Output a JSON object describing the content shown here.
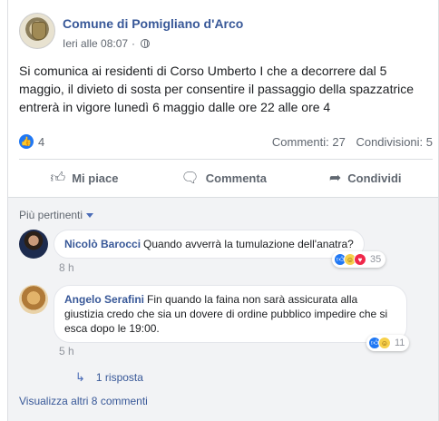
{
  "post": {
    "page_name": "Comune di Pomigliano d'Arco",
    "timestamp": "Ieri alle 08:07",
    "audience_icon": "globe-icon",
    "text": "Si comunica ai residenti di Corso Umberto I che a decorrere dal 5 maggio, il divieto di sosta per consentire il passaggio della spazzatrice entrerà in vigore lunedì 6 maggio dalle ore 22 alle ore 4",
    "likes_count": "4",
    "comments_count": "Commenti: 27",
    "shares_count": "Condivisioni: 5"
  },
  "actions": {
    "like": "Mi piace",
    "comment": "Commenta",
    "share": "Condividi"
  },
  "comments_section": {
    "filter_label": "Più pertinenti",
    "comments": [
      {
        "author": "Nicolò Barocci",
        "text": "Quando avverrà la tumulazione dell'anatra?",
        "time": "8 h",
        "reaction_count": "35"
      },
      {
        "author": "Angelo Serafini",
        "text": "Fin quando la faina non sarà assicurata alla giustizia credo che sia un dovere di ordine pubblico impedire che si esca dopo le 19:00.",
        "time": "5 h",
        "reaction_count": "11"
      }
    ],
    "reply_link": "1 risposta",
    "more_comments": "Visualizza altri 8 commenti"
  },
  "colors": {
    "link_blue": "#385898",
    "like_blue": "#2078f4",
    "secondary_text": "#606770",
    "comments_bg": "#f2f3f5"
  }
}
